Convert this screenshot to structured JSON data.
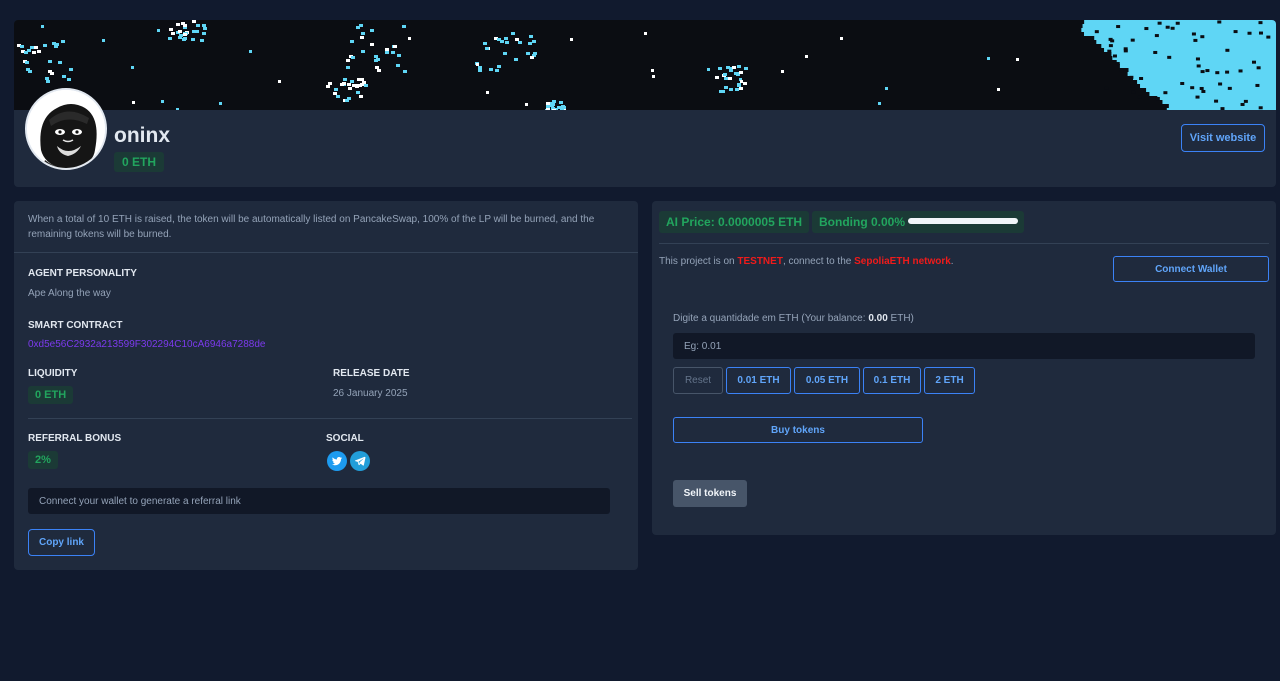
{
  "profile": {
    "name": "oninx",
    "balance": "0 ETH",
    "visit_label": "Visit website"
  },
  "details": {
    "info": "When a total of 10 ETH is raised, the token will be automatically listed on PancakeSwap, 100% of the LP will be burned, and the remaining tokens will be burned.",
    "personality_label": "AGENT PERSONALITY",
    "personality_value": "Ape Along the way",
    "contract_label": "SMART CONTRACT",
    "contract_value": "0xd5e56C2932a213599F302294C10cA6946a7288de",
    "liquidity_label": "LIQUIDITY",
    "liquidity_value": "0 ETH",
    "release_label": "RELEASE DATE",
    "release_value": "26 January 2025",
    "referral_label": "REFERRAL BONUS",
    "referral_value": "2%",
    "social_label": "SOCIAL",
    "referral_placeholder": "Connect your wallet to generate a referral link",
    "copy_label": "Copy link"
  },
  "trade": {
    "price_label": "AI Price:",
    "price_value": "0.0000005 ETH",
    "bonding_label": "Bonding",
    "bonding_value": "0.00%",
    "bonding_progress": 0,
    "notice_prefix": "This project is on ",
    "notice_testnet": "TESTNET",
    "notice_middle": ", connect to the ",
    "notice_network": "SepoliaETH network",
    "notice_suffix": ".",
    "connect_label": "Connect Wallet",
    "amount_prefix": "Digite a quantidade em ETH (Your balance: ",
    "amount_balance": "0.00",
    "amount_suffix": " ETH)",
    "amount_placeholder": "Eg: 0.01",
    "presets": [
      "Reset",
      "0.01 ETH",
      "0.05 ETH",
      "0.1 ETH",
      "2 ETH"
    ],
    "buy_label": "Buy tokens",
    "sell_label": "Sell tokens"
  },
  "colors": {
    "background": "#111a2e",
    "card": "#1f2a3d",
    "accent": "#3b82f6",
    "green": "#22a55e",
    "red": "#ef1b1b",
    "banner_pixel": "#5fd6f5"
  },
  "icons": [
    "twitter-icon",
    "telegram-icon"
  ]
}
